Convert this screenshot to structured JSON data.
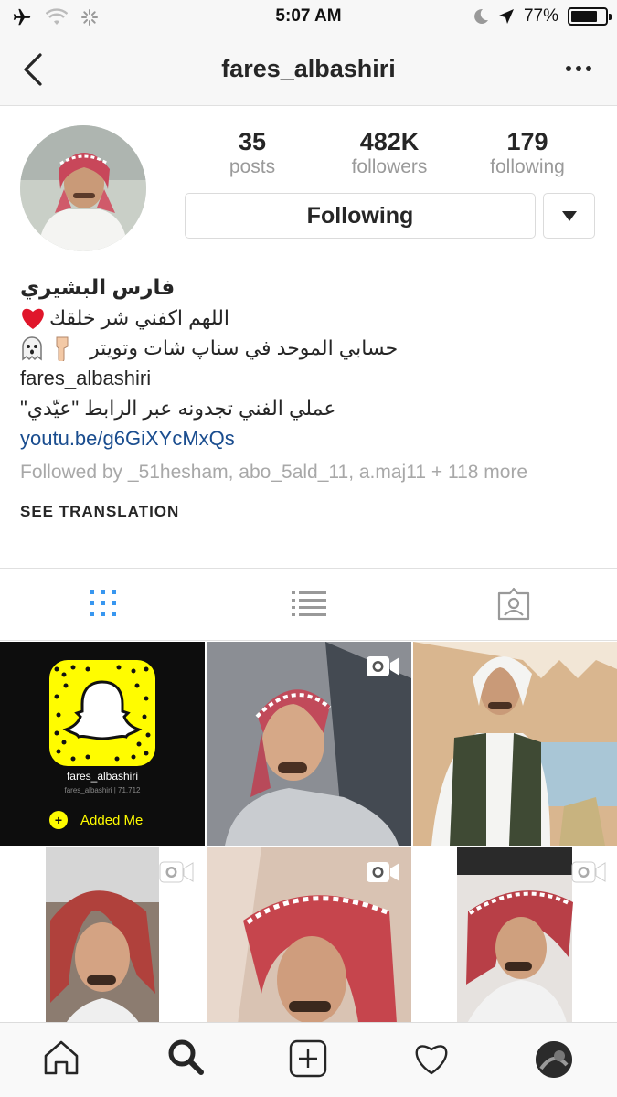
{
  "status_bar": {
    "time": "5:07 AM",
    "battery_text": "77%",
    "battery_level": 0.77
  },
  "nav": {
    "username": "fares_albashiri",
    "back_icon": "chevron-left-icon",
    "more_icon": "ellipsis-icon"
  },
  "profile": {
    "stats": [
      {
        "value": "35",
        "label": "posts"
      },
      {
        "value": "482K",
        "label": "followers"
      },
      {
        "value": "179",
        "label": "following"
      }
    ],
    "following_button": "Following"
  },
  "bio": {
    "name": "فارس البشيري",
    "line1": "اللهم اكفني شر خلقك",
    "line2": "حسابي الموحد في سناپ شات وتويتر",
    "line3": "fares_albashiri",
    "line4": "عملي الفني تجدونه عبر الرابط \"عيّدي\"",
    "link": "youtu.be/g6GiXYcMxQs",
    "followed_by": "Followed by _51hesham, abo_5ald_11, a.maj11 + 118 more",
    "see_translation": "SEE TRANSLATION"
  },
  "tabs": [
    {
      "icon": "grid-view-icon",
      "active": true
    },
    {
      "icon": "list-view-icon",
      "active": false
    },
    {
      "icon": "tagged-photos-icon",
      "active": false
    }
  ],
  "snapcode": {
    "username": "fares_albashiri",
    "sub": "fares_albashiri | 71,712",
    "added": "Added Me"
  },
  "colors": {
    "link": "#1a4d8f",
    "active_tab": "#3897f0",
    "snap_yellow": "#fffc00"
  }
}
